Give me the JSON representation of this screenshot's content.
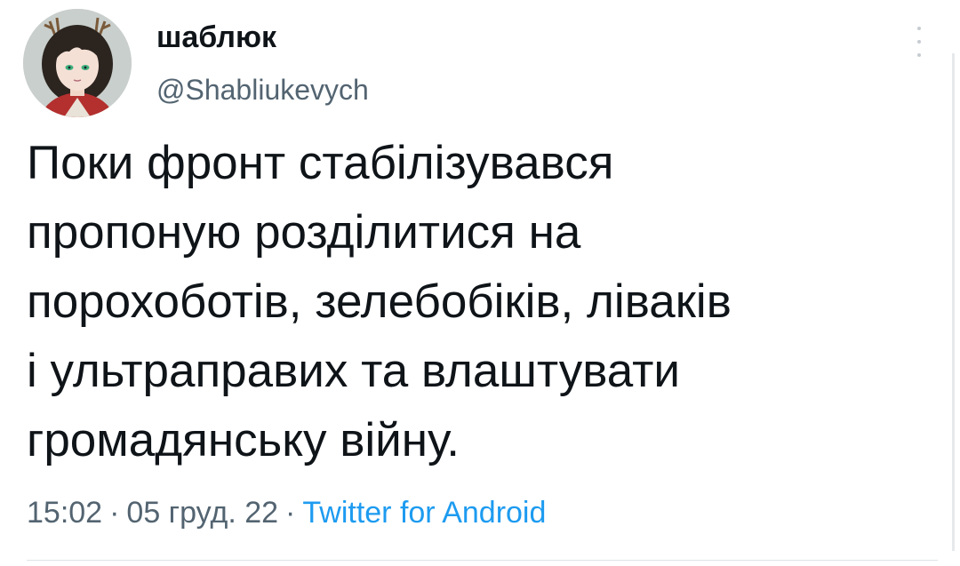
{
  "author": {
    "display_name": "шаблюк",
    "handle": "@Shabliukevych"
  },
  "tweet": {
    "lines": [
      "Поки фронт стабілізувався",
      "пропоную розділитися на",
      "порохоботів, зелебобіків, ліваків",
      "і ультраправих та влаштувати",
      "громадянську війну."
    ],
    "time": "15:02",
    "date": "05 груд. 22",
    "separator": "·",
    "source": "Twitter for Android"
  },
  "icons": {
    "more": "more-vertical-icon"
  },
  "colors": {
    "text": "#0f1419",
    "secondary": "#536471",
    "link": "#1d9bf0"
  }
}
